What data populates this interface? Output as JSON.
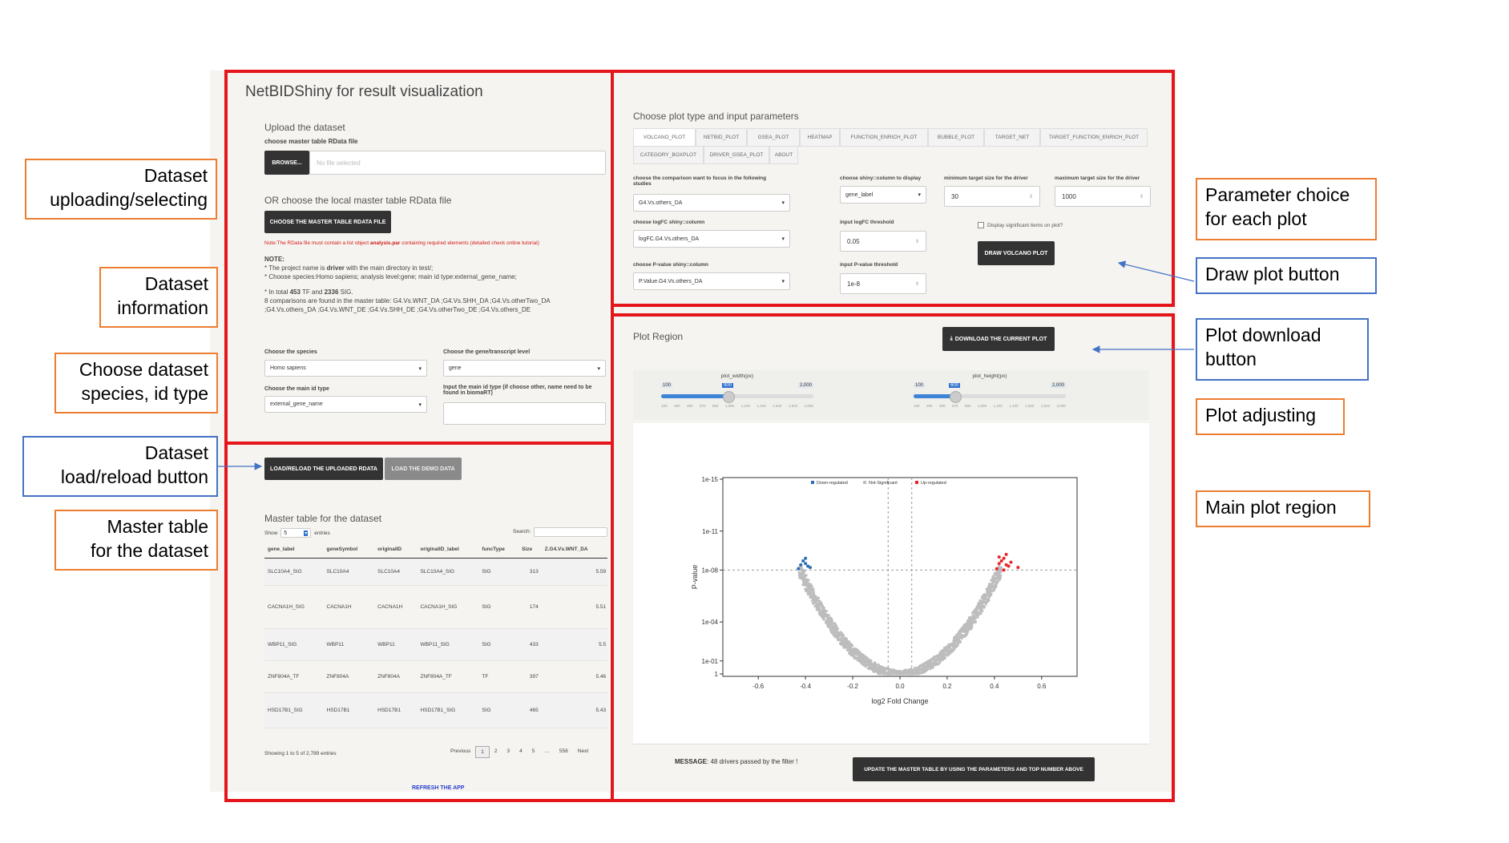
{
  "app": {
    "title": "NetBIDShiny for result visualization"
  },
  "upload": {
    "heading": "Upload the dataset",
    "choose_file_label": "choose master table RData file",
    "browse_label": "BROWSE...",
    "file_placeholder": "No file selected",
    "or_heading": "OR choose the local master table RData file",
    "choose_local_button": "CHOOSE THE MASTER TABLE RDATA FILE",
    "note_red_pre": "Note:The RData file must contain a list object ",
    "note_red_bold": "analysis.par",
    "note_red_post": " containing required elements (detailed check online tutorial)"
  },
  "info": {
    "note_title": "NOTE:",
    "line1_pre": "* The project name is ",
    "line1_bold": "driver",
    "line1_post": " with the main directory in test/;",
    "line2": "* Choose species:Homo sapiens; analysis level:gene; main id type:external_gene_name;",
    "line3_pre": "* In total ",
    "line3_tf": "453",
    "line3_mid": " TF and ",
    "line3_sig": "2336",
    "line3_post": " SIG.",
    "line4": "8 comparisons are found in the master table: G4.Vs.WNT_DA ;G4.Vs.SHH_DA ;G4.Vs.otherTwo_DA ;G4.Vs.others_DA ;G4.Vs.WNT_DE ;G4.Vs.SHH_DE ;G4.Vs.otherTwo_DE ;G4.Vs.others_DE"
  },
  "species": {
    "species_label": "Choose the species",
    "species_value": "Homo sapiens",
    "level_label": "Choose the gene/transcript level",
    "level_value": "gene",
    "idtype_label": "Choose the main id type",
    "idtype_value": "external_gene_name",
    "name_label": "Input the main id type (if choose other, name need to be found in biomaRT)"
  },
  "load": {
    "reload_button": "LOAD/RELOAD THE UPLOADED RDATA",
    "demo_button": "LOAD THE DEMO DATA"
  },
  "master_table": {
    "heading": "Master table for the dataset",
    "show": "Show",
    "show_value": "5",
    "entries": "entries",
    "search_label": "Search:",
    "columns": [
      "gene_label",
      "geneSymbol",
      "originalID",
      "originalID_label",
      "funcType",
      "Size",
      "Z.G4.Vs.WNT_DA",
      "Ave("
    ],
    "rows": [
      [
        "SLC10A4_SIG",
        "SLC10A4",
        "SLC10A4",
        "SLC10A4_SIG",
        "SIG",
        "313",
        "5.59"
      ],
      [
        "CACNA1H_SIG",
        "CACNA1H",
        "CACNA1H",
        "CACNA1H_SIG",
        "SIG",
        "174",
        "5.51"
      ],
      [
        "WBP11_SIG",
        "WBP11",
        "WBP11",
        "WBP11_SIG",
        "SIG",
        "433",
        "5.5"
      ],
      [
        "ZNF804A_TF",
        "ZNF804A",
        "ZNF804A",
        "ZNF804A_TF",
        "TF",
        "397",
        "5.46"
      ],
      [
        "HSD17B1_SIG",
        "HSD17B1",
        "HSD17B1",
        "HSD17B1_SIG",
        "SIG",
        "465",
        "5.43"
      ]
    ],
    "footer_info": "Showing 1 to 5 of 2,789 entries",
    "pagination": [
      "Previous",
      "1",
      "2",
      "3",
      "4",
      "5",
      "…",
      "558",
      "Next"
    ],
    "refresh": "REFRESH THE APP"
  },
  "plot_params": {
    "heading": "Choose plot type and input parameters",
    "tabs_row1": [
      "VOLCANO_PLOT",
      "NETBID_PLOT",
      "GSEA_PLOT",
      "HEATMAP",
      "FUNCTION_ENRICH_PLOT",
      "BUBBLE_PLOT",
      "TARGET_NET",
      "TARGET_FUNCTION_ENRICH_PLOT"
    ],
    "tabs_row2": [
      "CATEGORY_BOXPLOT",
      "DRIVER_GSEA_PLOT",
      "ABOUT"
    ],
    "comparison_label": "choose the comparison want to focus in the following studies",
    "comparison_value": "G4.Vs.others_DA",
    "logfc_col_label": "choose logFC shiny::column",
    "logfc_col_value": "logFC.G4.Vs.others_DA",
    "pval_col_label": "choose P-value shiny::column",
    "pval_col_value": "P.Value.G4.Vs.others_DA",
    "display_label": "choose shiny::column to display",
    "display_value": "gene_label",
    "logfc_thr_label": "input logFC threshold",
    "logfc_thr_value": "0.05",
    "pval_thr_label": "input P-value threshold",
    "pval_thr_value": "1e-8",
    "min_size_label": "minimum target size for the driver",
    "min_size_value": "30",
    "max_size_label": "maximum target size for the driver",
    "max_size_value": "1000",
    "display_sig_label": "Display significant items on plot?",
    "draw_button": "DRAW VOLCANO PLOT"
  },
  "plot_region": {
    "heading": "Plot Region",
    "download_button": "DOWNLOAD THE CURRENT PLOT",
    "width_slider": {
      "label": "plot_width(px)",
      "min": "100",
      "max": "2,000",
      "value": "900"
    },
    "height_slider": {
      "label": "plot_height(px)",
      "min": "100",
      "max": "2,000",
      "value": "600"
    },
    "slider_ticks": [
      "100",
      "290",
      "480",
      "670",
      "860",
      "1,050",
      "1,240",
      "1,430",
      "1,620",
      "1,810",
      "2,000"
    ],
    "message_bold": "MESSAGE",
    "message_text": ": 48 drivers passed by the filter !",
    "update_button": "UPDATE THE MASTER TABLE BY USING THE PARAMETERS AND TOP NUMBER ABOVE"
  },
  "chart_data": {
    "type": "scatter",
    "title": "",
    "xlabel": "log2 Fold Change",
    "ylabel": "P-value",
    "xlim": [
      -0.75,
      0.75
    ],
    "x_ticks": [
      "-0.6",
      "-0.4",
      "-0.2",
      "0.0",
      "0.2",
      "0.4",
      "0.6"
    ],
    "y_ticks": [
      "1e-15",
      "1e-11",
      "1e-08",
      "1e-04",
      "1e-01",
      "1"
    ],
    "y_scale": "-log10",
    "thresholds": {
      "logfc": 0.05,
      "pvalue": "1e-8"
    },
    "legend": [
      "Down-regulated",
      "Not-Significant",
      "Up-regulated"
    ],
    "legend_position": "top",
    "colors": {
      "down": "#2c6db5",
      "ns": "#bdbdbd",
      "up": "#e8262b"
    },
    "series": [
      {
        "name": "Down-regulated",
        "points": [
          [
            -0.42,
            8.4
          ],
          [
            -0.4,
            8.5
          ],
          [
            -0.41,
            8.7
          ],
          [
            -0.39,
            8.3
          ],
          [
            -0.43,
            8.1
          ],
          [
            -0.4,
            8.9
          ],
          [
            -0.38,
            8.2
          ]
        ]
      },
      {
        "name": "Up-regulated",
        "points": [
          [
            0.42,
            8.5
          ],
          [
            0.44,
            8.9
          ],
          [
            0.45,
            9.2
          ],
          [
            0.43,
            8.7
          ],
          [
            0.46,
            8.3
          ],
          [
            0.41,
            8.1
          ],
          [
            0.47,
            8.6
          ],
          [
            0.44,
            8.0
          ],
          [
            0.5,
            8.2
          ],
          [
            0.42,
            9.0
          ],
          [
            0.45,
            8.4
          ]
        ]
      }
    ]
  },
  "callouts": {
    "uploading": "Dataset\nuploading/selecting",
    "information": "Dataset\ninformation",
    "species": "Choose dataset\nspecies, id type",
    "load_button": "Dataset\nload/reload button",
    "master_table": "Master table\nfor the dataset",
    "param_choice": "Parameter choice\nfor each plot",
    "draw_button": "Draw plot button",
    "download_button": "Plot download\nbutton",
    "adjusting": "Plot adjusting",
    "main_region": "Main plot region"
  }
}
